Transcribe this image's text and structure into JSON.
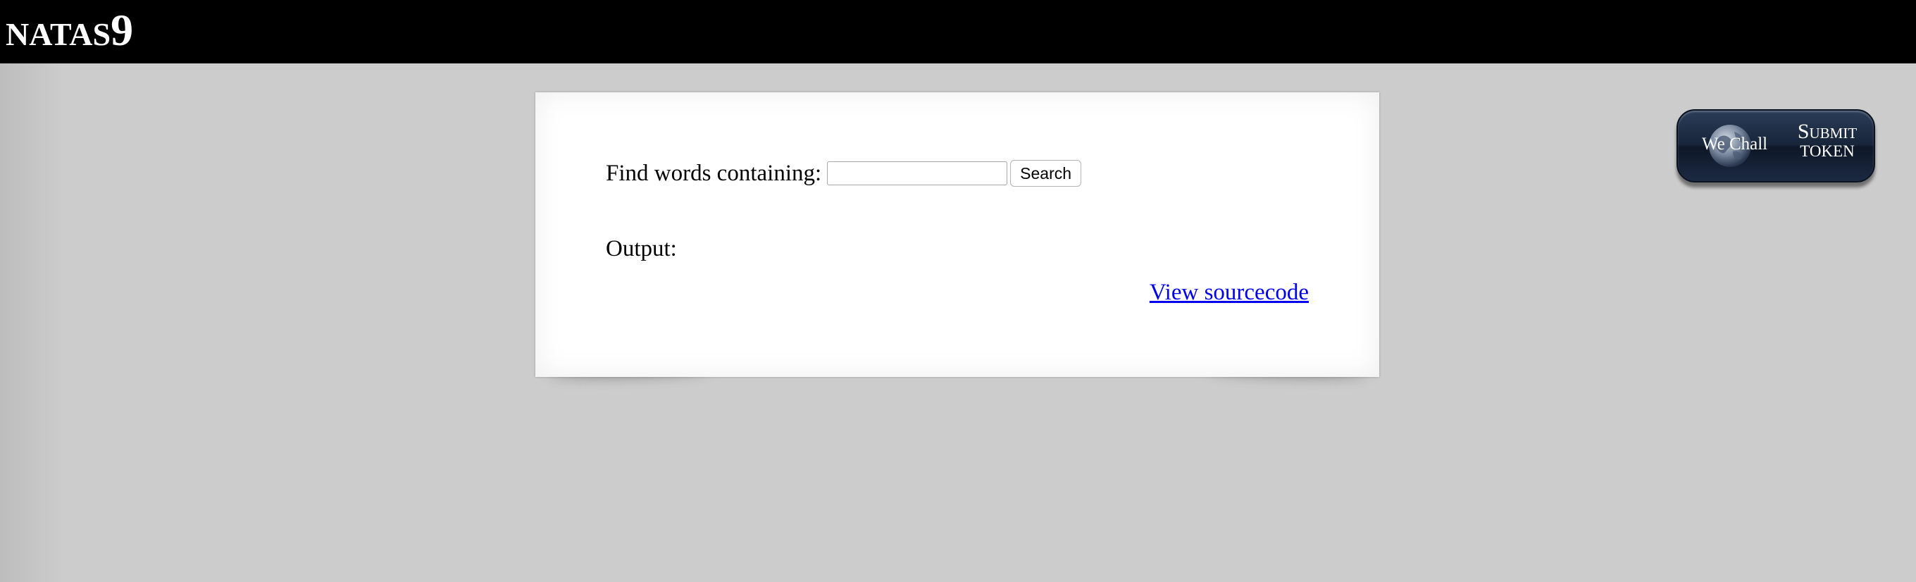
{
  "header": {
    "brand_name": "NATAS",
    "brand_level": "9"
  },
  "form": {
    "label": "Find words containing:",
    "input_value": "",
    "button_label": "Search"
  },
  "output": {
    "label": "Output:"
  },
  "links": {
    "source": "View sourcecode"
  },
  "wechall": {
    "logo_text": "We Chall",
    "submit_line1": "Submit",
    "submit_line2": "TOKEN"
  }
}
